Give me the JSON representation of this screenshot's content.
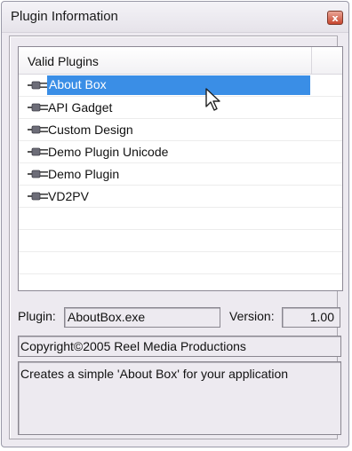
{
  "window": {
    "title": "Plugin Information",
    "close_symbol": "x"
  },
  "list": {
    "header": "Valid Plugins",
    "items": [
      {
        "label": "About Box",
        "selected": true
      },
      {
        "label": "API Gadget",
        "selected": false
      },
      {
        "label": "Custom Design",
        "selected": false
      },
      {
        "label": "Demo Plugin Unicode",
        "selected": false
      },
      {
        "label": "Demo Plugin",
        "selected": false
      },
      {
        "label": "VD2PV",
        "selected": false
      }
    ]
  },
  "details": {
    "plugin_label": "Plugin:",
    "plugin_value": "AboutBox.exe",
    "version_label": "Version:",
    "version_value": "1.00",
    "copyright": "Copyright©2005 Reel Media Productions",
    "description": "Creates a simple 'About Box' for your application"
  },
  "colors": {
    "selection": "#3a8ee6",
    "window_bg": "#edeaf0",
    "close_button": "#c8462f"
  },
  "icons": {
    "plug": "plug-icon",
    "cursor": "mouse-cursor-icon",
    "close": "close-icon"
  }
}
